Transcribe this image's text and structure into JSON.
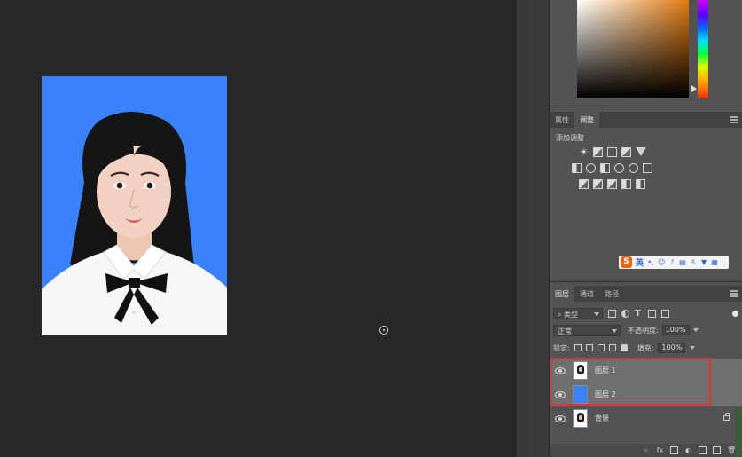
{
  "colors": {
    "canvas_bg": "#282828",
    "photo_bg": "#3a82fb",
    "panel_bg": "#535353",
    "highlight": "#e83030",
    "selected_layer": "#6f6f6f"
  },
  "properties_panel": {
    "tabs": [
      {
        "label": "属性"
      },
      {
        "label": "调整"
      }
    ],
    "active_tab": "调整",
    "add_adjustment_label": "添加调整",
    "adjustment_icons": [
      [
        "brightness-contrast-icon",
        "levels-icon",
        "curves-icon",
        "exposure-icon",
        "vibrance-icon"
      ],
      [
        "hue-saturation-icon",
        "color-balance-icon",
        "black-white-icon",
        "photo-filter-icon",
        "channel-mixer-icon",
        "color-lookup-icon"
      ],
      [
        "invert-icon",
        "posterize-icon",
        "threshold-icon",
        "selective-color-icon",
        "gradient-map-icon"
      ]
    ]
  },
  "ime_toolbar": {
    "logo": "S",
    "language": "英",
    "icons": [
      "punctuation-icon",
      "emoji-icon",
      "mic-icon",
      "keyboard-icon",
      "user-icon",
      "skin-icon",
      "grid-icon"
    ]
  },
  "layers_panel": {
    "tabs": [
      {
        "label": "图层"
      },
      {
        "label": "通道"
      },
      {
        "label": "路径"
      }
    ],
    "active_tab": "图层",
    "filter_label": "类型",
    "blend_mode": "正常",
    "opacity_label": "不透明度:",
    "opacity_value": "100%",
    "lock_label": "锁定:",
    "fill_label": "填充:",
    "fill_value": "100%",
    "layers": [
      {
        "name": "图层 1",
        "selected": true,
        "thumb": "portrait",
        "locked": false
      },
      {
        "name": "图层 2",
        "selected": true,
        "thumb": "blue",
        "locked": false
      },
      {
        "name": "背景",
        "selected": false,
        "thumb": "portrait",
        "locked": true
      }
    ],
    "bottom_icons": [
      "link-icon",
      "fx",
      "mask-icon",
      "adjustment-layer-icon",
      "group-folder-icon",
      "new-layer-icon",
      "trash-icon"
    ],
    "fx_label": "fx"
  }
}
